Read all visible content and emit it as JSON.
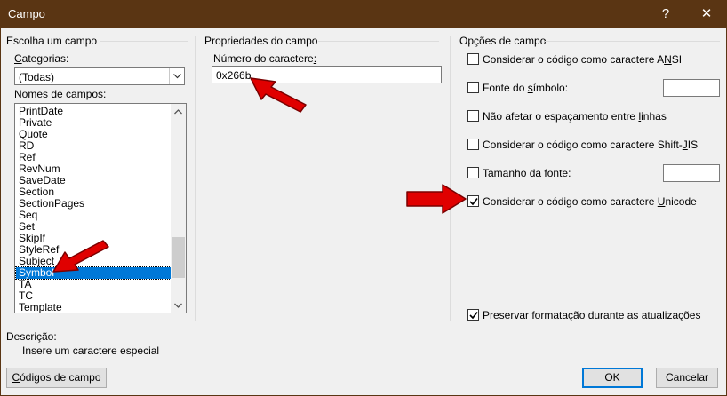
{
  "window": {
    "title": "Campo",
    "help_glyph": "?",
    "close_glyph": "✕"
  },
  "left": {
    "group_title": "Escolha um campo",
    "categories_label": "Categorias:",
    "categories_value": "(Todas)",
    "names_label": "Nomes de campos:",
    "field_names": [
      "PrintDate",
      "Private",
      "Quote",
      "RD",
      "Ref",
      "RevNum",
      "SaveDate",
      "Section",
      "SectionPages",
      "Seq",
      "Set",
      "SkipIf",
      "StyleRef",
      "Subject",
      "Symbol",
      "TA",
      "TC",
      "Template"
    ],
    "selected_field": "Symbol"
  },
  "middle": {
    "group_title": "Propriedades do campo",
    "char_number_label": "Número do caractere:",
    "char_number_value": "0x266b"
  },
  "right": {
    "group_title": "Opções de campo",
    "options": [
      {
        "label": "Considerar o código como caractere ANSI",
        "checked": false
      },
      {
        "label": "Fonte do símbolo:",
        "checked": false
      },
      {
        "label": "Não afetar o espaçamento entre linhas",
        "checked": false
      },
      {
        "label": "Considerar o código como caractere Shift-JIS",
        "checked": false
      },
      {
        "label": "Tamanho da fonte:",
        "checked": false
      },
      {
        "label": "Considerar o código como caractere Unicode",
        "checked": true
      }
    ],
    "preserve_label": "Preservar formatação durante as atualizações",
    "preserve_checked": true
  },
  "description": {
    "label": "Descrição:",
    "text": "Insere um caractere especial"
  },
  "buttons": {
    "field_codes": "Códigos de campo",
    "ok": "OK",
    "cancel": "Cancelar"
  },
  "colors": {
    "titlebar": "#5a3513",
    "selection": "#0078d7",
    "annotation_arrow": "#e00000"
  }
}
